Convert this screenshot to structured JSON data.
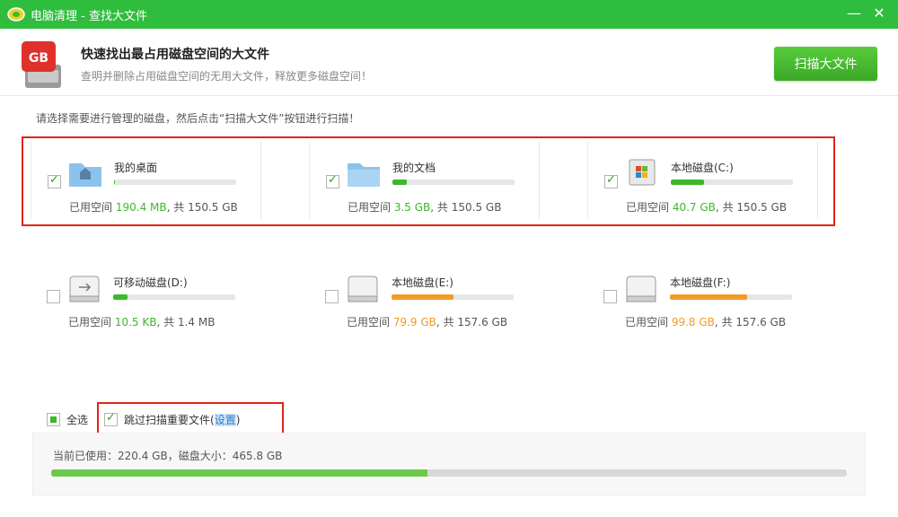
{
  "window": {
    "title": "电脑清理 - 查找大文件",
    "minimize": "—",
    "close": "✕"
  },
  "header": {
    "title": "快速找出最占用磁盘空间的大文件",
    "subtitle": "查明并删除占用磁盘空间的无用大文件，释放更多磁盘空间！",
    "scan_button": "扫描大文件",
    "icon_text": "GB"
  },
  "instruction": "请选择需要进行管理的磁盘，然后点击“扫描大文件”按钮进行扫描！",
  "colors": {
    "accent_green": "#2fbd3e",
    "usage_green": "#3cb82a",
    "usage_orange": "#f39a27",
    "highlight_red": "#e2231a"
  },
  "drives": [
    {
      "name": "我的桌面",
      "used": "190.4 MB",
      "total": "共 150.5 GB",
      "label_prefix": "已用空间",
      "fraction": 0.01,
      "checked": true,
      "icon": "desktop-folder-icon",
      "color": "green"
    },
    {
      "name": "我的文档",
      "used": "3.5 GB",
      "total": "共 150.5 GB",
      "label_prefix": "已用空间",
      "fraction": 0.12,
      "checked": true,
      "icon": "documents-folder-icon",
      "color": "green"
    },
    {
      "name": "本地磁盘(C:)",
      "used": "40.7 GB",
      "total": "共 150.5 GB",
      "label_prefix": "已用空间",
      "fraction": 0.27,
      "checked": true,
      "icon": "system-drive-icon",
      "color": "green"
    },
    {
      "name": "可移动磁盘(D:)",
      "used": "10.5 KB",
      "total": "共 1.4 MB",
      "label_prefix": "已用空间",
      "fraction": 0.12,
      "checked": false,
      "icon": "usb-drive-icon",
      "color": "green"
    },
    {
      "name": "本地磁盘(E:)",
      "used": "79.9 GB",
      "total": "共 157.6 GB",
      "label_prefix": "已用空间",
      "fraction": 0.51,
      "checked": false,
      "icon": "hard-drive-icon",
      "color": "orange"
    },
    {
      "name": "本地磁盘(F:)",
      "used": "99.8 GB",
      "total": "共 157.6 GB",
      "label_prefix": "已用空间",
      "fraction": 0.63,
      "checked": false,
      "icon": "hard-drive-icon",
      "color": "orange"
    }
  ],
  "bottom": {
    "select_all": "全选",
    "select_all_checked": "partial",
    "skip_label": "跳过扫描重要文件(",
    "skip_link": "设置",
    "skip_close": ")",
    "summary": "当前已使用：220.4 GB，磁盘大小：465.8 GB",
    "summary_fraction": 0.473
  }
}
